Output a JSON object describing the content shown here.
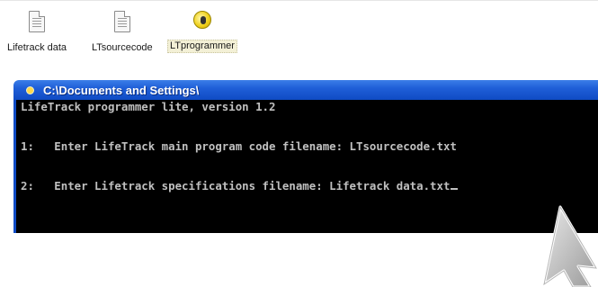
{
  "desktop": {
    "icons": [
      {
        "label": "Lifetrack data",
        "icon": "text-document-icon"
      },
      {
        "label": "LTsourcecode",
        "icon": "text-document-icon"
      },
      {
        "label": "LTprogrammer",
        "icon": "program-icon",
        "selected": true
      }
    ]
  },
  "console_window": {
    "title": "C:\\Documents and Settings\\",
    "icon": "console-app-icon",
    "lines": [
      "LifeTrack programmer lite, version 1.2",
      "1:   Enter LifeTrack main program code filename: LTsourcecode.txt",
      "2:   Enter Lifetrack specifications filename: Lifetrack data.txt"
    ]
  },
  "cursor": {
    "icon": "mouse-pointer-icon"
  },
  "colors": {
    "titlebar": "#1f5fd8",
    "console_bg": "#000000",
    "console_text": "#c0c0c0"
  }
}
